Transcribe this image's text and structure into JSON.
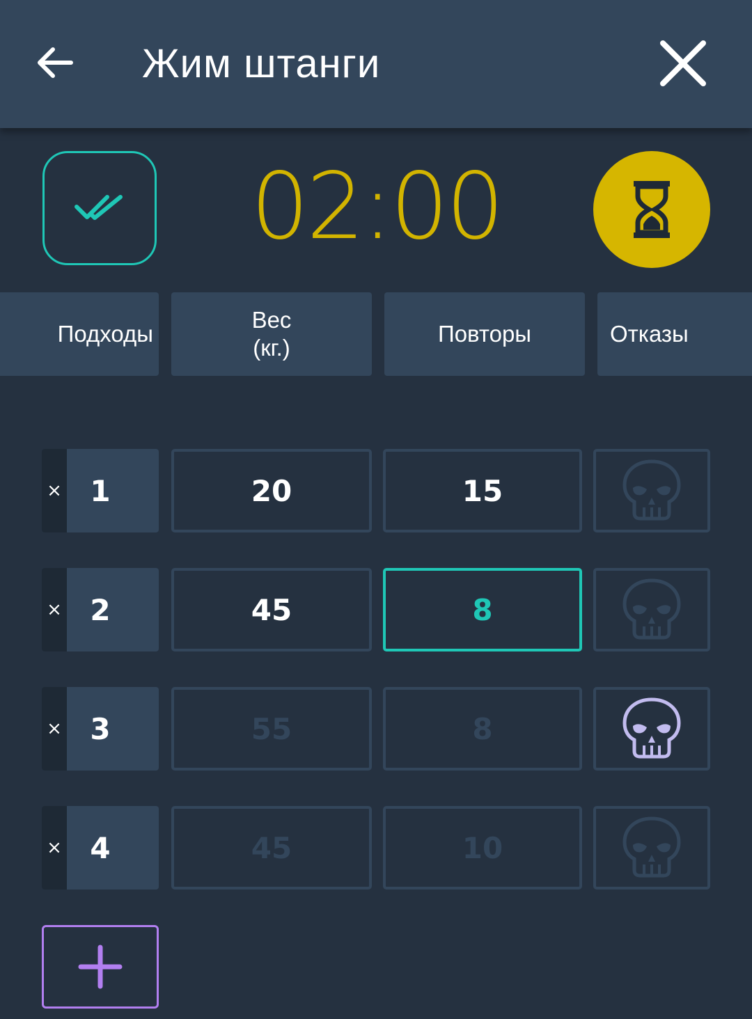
{
  "header": {
    "title": "Жим штанги",
    "back_icon": "arrow-left-icon",
    "close_icon": "close-icon"
  },
  "timer": {
    "display": "02:00",
    "done_icon": "double-check-icon",
    "timer_icon": "hourglass-icon"
  },
  "columns": {
    "sets": "Подходы",
    "weight_line1": "Вес",
    "weight_line2": "(кг.)",
    "reps": "Повторы",
    "fails": "Отказы"
  },
  "rows": [
    {
      "delete": "×",
      "set": "1",
      "weight": "20",
      "reps": "15",
      "fail": false
    },
    {
      "delete": "×",
      "set": "2",
      "weight": "45",
      "reps": "8",
      "fail": false
    },
    {
      "delete": "×",
      "set": "3",
      "weight": "55",
      "reps": "8",
      "fail": true
    },
    {
      "delete": "×",
      "set": "4",
      "weight": "45",
      "reps": "10",
      "fail": false
    }
  ],
  "colors": {
    "accent_teal": "#1fc7b6",
    "timer_yellow": "#d6b600",
    "add_purple": "#b27ff0",
    "skull_active": "#c2bcef",
    "skull_inactive": "#33465b"
  }
}
